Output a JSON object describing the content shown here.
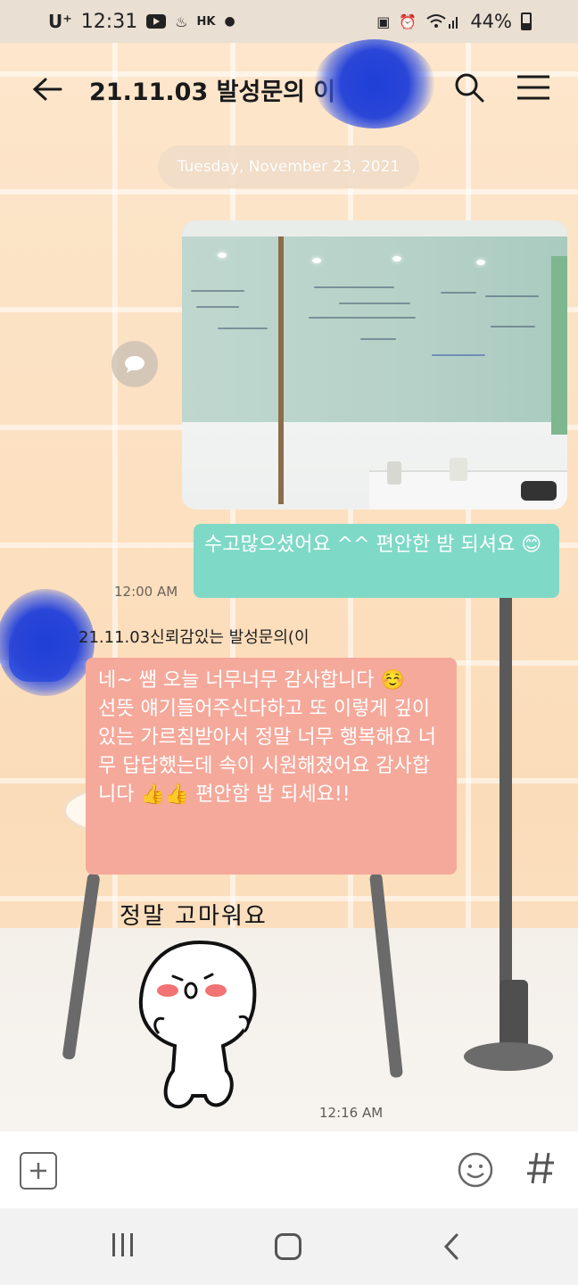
{
  "status_bar": {
    "carrier": "U⁺",
    "time": "12:31",
    "region": "HK",
    "battery": "44%"
  },
  "header": {
    "title": "21.11.03 발성문의 이"
  },
  "chat": {
    "date_divider": "Tuesday, November 23, 2021",
    "messages": [
      {
        "type": "image",
        "from": "me",
        "description_icon": "photo"
      },
      {
        "type": "text",
        "from": "me",
        "text": "수고많으셨어요 ^^ 편안한 밤 되셔요 😊",
        "time": "12:00 AM"
      },
      {
        "type": "text",
        "from": "other",
        "sender": "21.11.03신뢰감있는 발성문의(이",
        "text": "네~ 쌤 오늘 너무너무 감사합니다 ☺️\n선뜻 얘기들어주신다하고 또 이렇게 깊이있는 가르침받아서 정말 너무 행복해요 너무 답답했는데 속이 시원해졌어요 감사합니다 👍👍 편안함 밤 되세요!!"
      },
      {
        "type": "sticker",
        "from": "other",
        "text": "정말 고마워요",
        "time": "12:16 AM"
      }
    ]
  },
  "colors": {
    "my_bubble": "#7fd9c7",
    "other_bubble": "#f5a99b",
    "background": "#fbe9d4"
  },
  "icons": {
    "back": "arrow-left-icon",
    "search": "search-icon",
    "menu": "hamburger-menu-icon",
    "share": "share-chat-icon",
    "add": "plus-square-icon",
    "emoji": "emoji-icon",
    "hash": "hash-icon"
  }
}
